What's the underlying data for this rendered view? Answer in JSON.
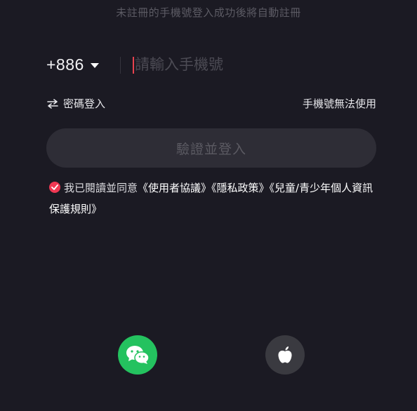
{
  "hint": "未註冊的手機號登入成功後將自動註冊",
  "phone": {
    "country_code": "+886",
    "placeholder": "請輸入手機號",
    "value": ""
  },
  "links": {
    "password_login": "密碼登入",
    "number_unavailable": "手機號無法使用"
  },
  "login_button": "驗證並登入",
  "agreement": {
    "checked": true,
    "prefix": "我已閱讀並同意",
    "terms": "《使用者協議》",
    "privacy": "《隱私政策》",
    "children": "《兒童/青少年個人資訊保護規則》"
  },
  "social": {
    "wechat_icon": "wechat-icon",
    "apple_icon": "apple-icon"
  },
  "colors": {
    "background": "#1b1a23",
    "accent": "#f03853",
    "wechat": "#24c25f",
    "button_disabled": "#2e2d36"
  }
}
